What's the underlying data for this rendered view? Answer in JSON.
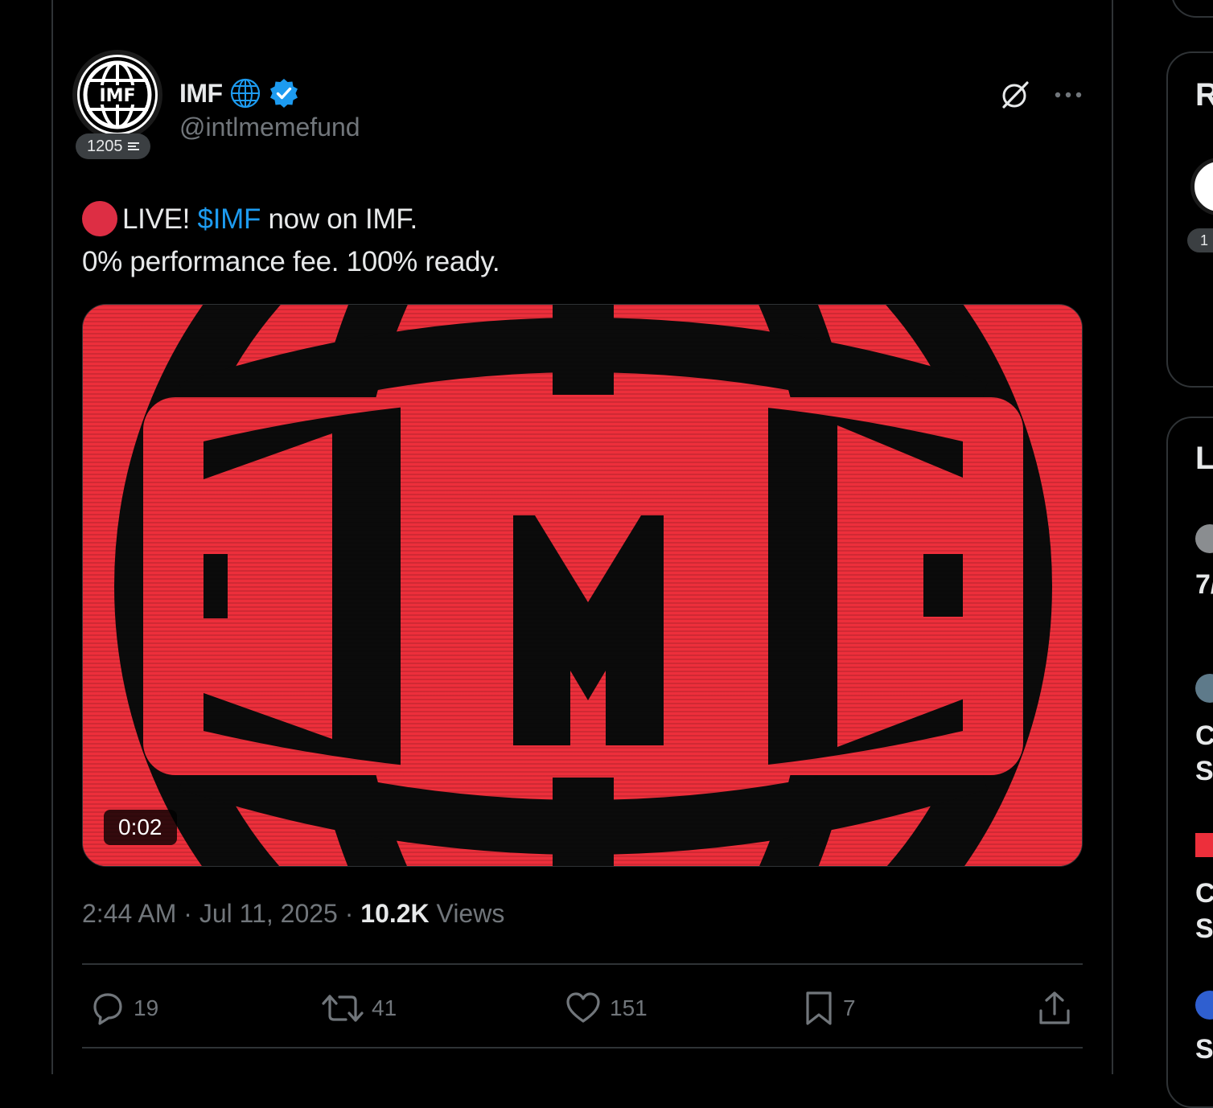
{
  "tweet": {
    "author": {
      "name": "IMF",
      "handle": "@intlmemefund",
      "score": "1205",
      "avatar_text": "IMF"
    },
    "text": {
      "live": "LIVE!",
      "cashtag": "$IMF",
      "line1_rest": " now on IMF.",
      "line2": "0% performance fee. 100% ready."
    },
    "media": {
      "duration": "0:02",
      "logo_text": "IMF"
    },
    "meta": {
      "time": "2:44 AM",
      "sep1": " · ",
      "date": "Jul 11, 2025",
      "sep2": " · ",
      "views_count": "10.2K",
      "views_label": " Views"
    },
    "actions": {
      "replies": "19",
      "reposts": "41",
      "likes": "151",
      "bookmarks": "7"
    }
  },
  "sidebar": {
    "card1_letter": "R",
    "card1_score": "1",
    "card2_letter": "L",
    "row_letters": [
      "7/",
      "C",
      "S",
      "C",
      "S",
      "S"
    ]
  },
  "colors": {
    "background": "#000000",
    "text": "#e7e9ea",
    "muted": "#71767b",
    "link": "#1d9bf0",
    "verified": "#1d9bf0",
    "live": "#dd2e44",
    "media_red": "#ed2f3b"
  }
}
